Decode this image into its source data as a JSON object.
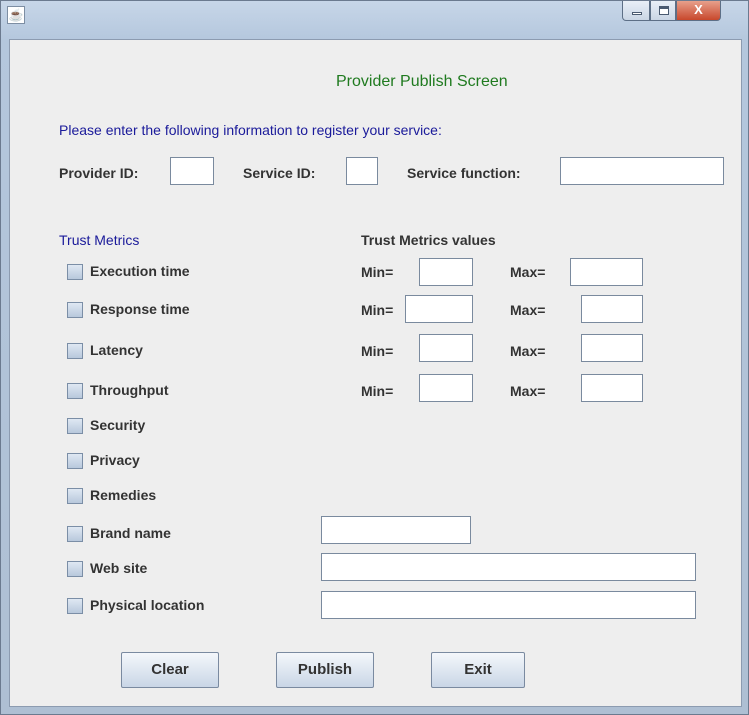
{
  "window": {
    "icon": "java-app-icon",
    "close_glyph": "X"
  },
  "screen_title": "Provider Publish Screen",
  "instructions": "Please enter the following information to register your service:",
  "ids": {
    "provider_id_label": "Provider ID:",
    "service_id_label": "Service ID:",
    "service_function_label": "Service function:",
    "provider_id_value": "",
    "service_id_value": "",
    "service_function_value": ""
  },
  "metrics_header": "Trust Metrics",
  "values_header": "Trust Metrics values",
  "min_label_1": "Min=",
  "min_label_2": "Min=",
  "min_label_3": "Min=",
  "min_label_4": "Min=",
  "max_label_1": "Max=",
  "max_label_2": "Max=",
  "max_label_3": "Max=",
  "max_label_4": "Max=",
  "metrics": [
    {
      "label": "Execution time",
      "checked": false
    },
    {
      "label": "Response time",
      "checked": false
    },
    {
      "label": "Latency",
      "checked": false
    },
    {
      "label": "Throughput",
      "checked": false
    },
    {
      "label": "Security",
      "checked": false
    },
    {
      "label": "Privacy",
      "checked": false
    },
    {
      "label": "Remedies",
      "checked": false
    },
    {
      "label": "Brand name",
      "checked": false
    },
    {
      "label": "Web site",
      "checked": false
    },
    {
      "label": "Physical location",
      "checked": false
    }
  ],
  "buttons": {
    "clear": "Clear",
    "publish": "Publish",
    "exit": "Exit"
  }
}
